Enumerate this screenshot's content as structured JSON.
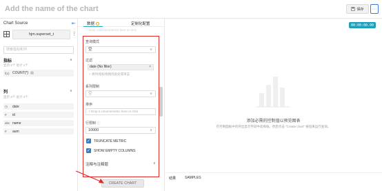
{
  "header": {
    "title": "Add the name of the chart",
    "save_label": "保存",
    "more_label": "···"
  },
  "left": {
    "datasource_label": "Chart Source",
    "datasource_name": "hjm.superset_t",
    "search_placeholder": "搜索指标和列",
    "metrics_title": "指标",
    "metrics_sub": "显示 1个 总计 1个",
    "metric_item": "COUNT(*)",
    "metric_glyph": "f(x)",
    "columns_title": "列",
    "columns_sub": "显示 4个 总计 4个",
    "columns": [
      {
        "glyph": "◷",
        "name": "date"
      },
      {
        "glyph": "#",
        "name": "id"
      },
      {
        "glyph": "abc",
        "name": "name"
      },
      {
        "glyph": "#",
        "name": "aum"
      }
    ]
  },
  "mid": {
    "tab_data": "数据",
    "tab_custom": "定制化配置",
    "faded_hint": "+ Drop columns/metrics here or click",
    "query_mode_label": "查询模式",
    "query_mode_value": "空",
    "filters_label": "过滤",
    "filter_tag": "date (No filter)",
    "filter_add": "+ 将列/指标拖拽到此处或单击",
    "series_limit_label": "系列限制",
    "series_limit_value": "空",
    "sort_label": "排序",
    "sort_placeholder": "+ Drop a column/metric here or click",
    "row_limit_label": "行限制",
    "row_limit_value": "10000",
    "truncate_label": "TRUNCATE METRIC",
    "show_empty_label": "SHOW EMPTY COLUMNS",
    "annotations_label": "注释与注释层",
    "create_chart_label": "CREATE CHART"
  },
  "right": {
    "timer": "00:00:00.00",
    "empty_title": "添加必需的控制值以预览图表",
    "empty_desc": "在控制面板中的突出显示字段中选择值。然后点击 \"Create chart\" 按钮来运行查询。",
    "results_tab": "结果",
    "samples_tab": "SAMPLES"
  },
  "colors": {
    "accent": "#20a7c9",
    "highlight_box": "#e02b2b",
    "checkbox": "#2f80c7"
  }
}
